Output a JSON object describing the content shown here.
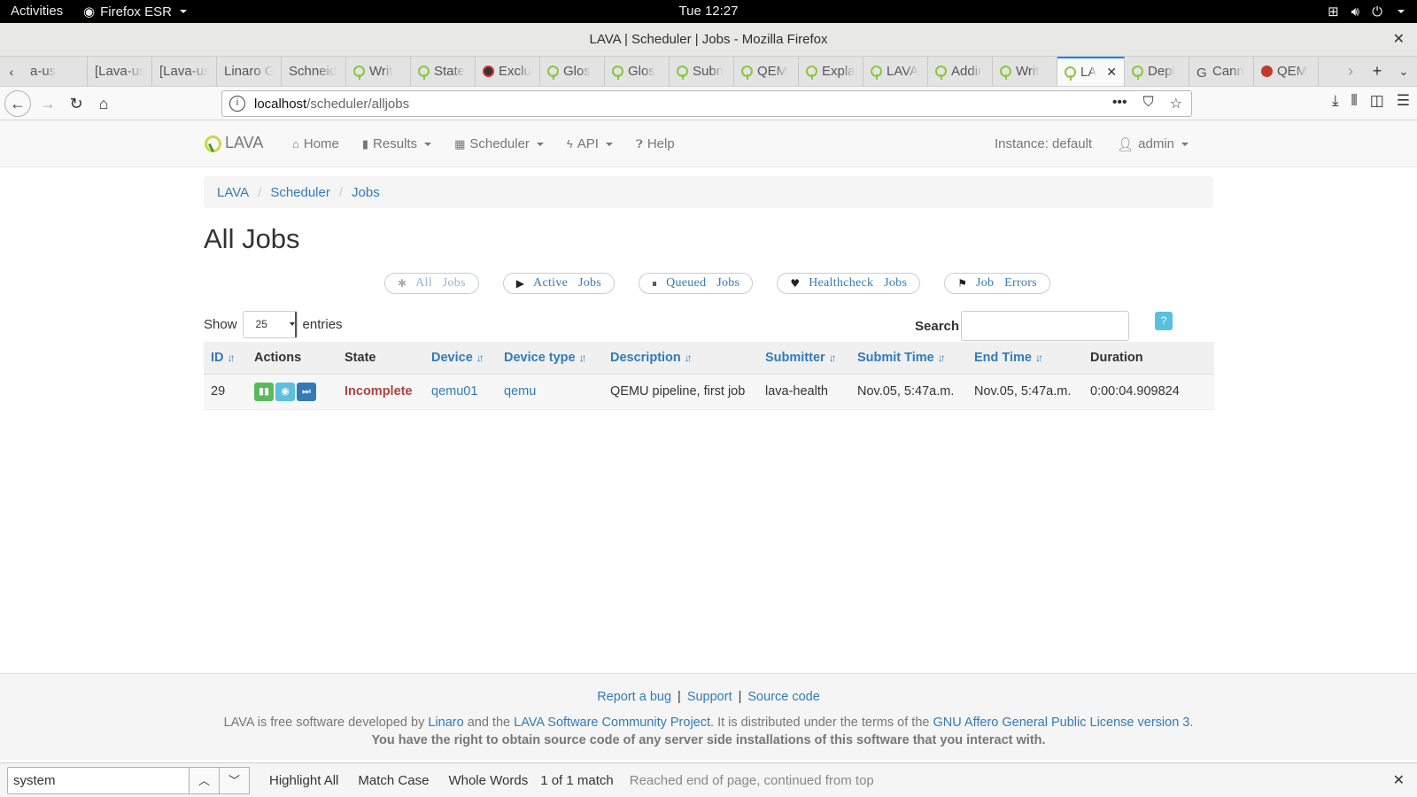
{
  "system": {
    "activities": "Activities",
    "app_name": "Firefox ESR",
    "clock": "Tue 12:27"
  },
  "window": {
    "title": "LAVA | Scheduler | Jobs - Mozilla Firefox"
  },
  "tabs": [
    {
      "label": "a-us",
      "icon": "none"
    },
    {
      "label": "[Lava-us",
      "icon": "none"
    },
    {
      "label": "[Lava-us",
      "icon": "none"
    },
    {
      "label": "Linaro G",
      "icon": "none"
    },
    {
      "label": "Schneid",
      "icon": "none"
    },
    {
      "label": "Writ",
      "icon": "lava"
    },
    {
      "label": "State",
      "icon": "lava"
    },
    {
      "label": "Exclu",
      "icon": "excl"
    },
    {
      "label": "Glos",
      "icon": "lava"
    },
    {
      "label": "Glos",
      "icon": "lava"
    },
    {
      "label": "Subn",
      "icon": "lava"
    },
    {
      "label": "QEM",
      "icon": "lava"
    },
    {
      "label": "Expla",
      "icon": "lava"
    },
    {
      "label": "LAVA",
      "icon": "lava"
    },
    {
      "label": "Addir",
      "icon": "lava"
    },
    {
      "label": "Writ",
      "icon": "lava"
    },
    {
      "label": "LA",
      "icon": "lava",
      "active": true
    },
    {
      "label": "Depl",
      "icon": "lava"
    },
    {
      "label": "Cann",
      "icon": "google"
    },
    {
      "label": "QEM",
      "icon": "qemu"
    }
  ],
  "urlbar": {
    "host": "localhost",
    "path": "/scheduler/alljobs"
  },
  "lava_nav": {
    "brand": "LAVA",
    "menu": [
      {
        "label": "Home",
        "icon": "home-icon",
        "dropdown": false
      },
      {
        "label": "Results",
        "icon": "signal-icon",
        "dropdown": true
      },
      {
        "label": "Scheduler",
        "icon": "calendar-icon",
        "dropdown": true
      },
      {
        "label": "API",
        "icon": "flash-icon",
        "dropdown": true
      },
      {
        "label": "Help",
        "icon": "question-icon",
        "dropdown": false
      }
    ],
    "instance": "Instance: default",
    "user": "admin"
  },
  "breadcrumb": [
    "LAVA",
    "Scheduler",
    "Jobs"
  ],
  "page_title": "All Jobs",
  "filters": [
    {
      "label": "All Jobs",
      "icon": "asterisk-icon",
      "disabled": true
    },
    {
      "label": "Active Jobs",
      "icon": "play-icon",
      "disabled": false
    },
    {
      "label": "Queued Jobs",
      "icon": "pause-icon",
      "disabled": false
    },
    {
      "label": "Healthcheck Jobs",
      "icon": "heart-icon",
      "disabled": false
    },
    {
      "label": "Job Errors",
      "icon": "flag-icon",
      "disabled": false
    }
  ],
  "table_controls": {
    "show_label": "Show",
    "page_size": "25",
    "entries_label": "entries",
    "search_label": "Search",
    "search_value": "",
    "help_label": "?"
  },
  "table": {
    "columns": [
      {
        "label": "ID",
        "sortable": true
      },
      {
        "label": "Actions",
        "sortable": false
      },
      {
        "label": "State",
        "sortable": false
      },
      {
        "label": "Device",
        "sortable": true
      },
      {
        "label": "Device type",
        "sortable": true
      },
      {
        "label": "Description",
        "sortable": true
      },
      {
        "label": "Submitter",
        "sortable": true
      },
      {
        "label": "Submit Time",
        "sortable": true
      },
      {
        "label": "End Time",
        "sortable": true
      },
      {
        "label": "Duration",
        "sortable": false
      }
    ],
    "rows": [
      {
        "id": "29",
        "state": "Incomplete",
        "device": "qemu01",
        "device_type": "qemu",
        "description": "QEMU pipeline, first job",
        "submitter": "lava-health",
        "submit_time": "Nov.05, 5:47a.m.",
        "end_time": "Nov.05, 5:47a.m.",
        "duration": "0:00:04.909824"
      }
    ]
  },
  "footer": {
    "report_bug": "Report a bug",
    "support": "Support",
    "source_code": "Source code",
    "line2_a": "LAVA is free software developed by ",
    "linaro": "Linaro",
    "line2_b": " and the ",
    "lava_project": "LAVA Software Community Project",
    "line2_c": ". It is distributed under the terms of the ",
    "license": "GNU Affero General Public License version 3",
    "line2_d": ".",
    "line3": "You have the right to obtain source code of any server side installations of this software that you interact with."
  },
  "findbar": {
    "query": "system",
    "highlight_all": "Highlight All",
    "match_case": "Match Case",
    "whole_words": "Whole Words",
    "count": "1 of 1 match",
    "status": "Reached end of page, continued from top"
  },
  "colors": {
    "link": "#337ab7",
    "incomplete": "#a94442",
    "firefox_accent": "#0a84ff"
  }
}
